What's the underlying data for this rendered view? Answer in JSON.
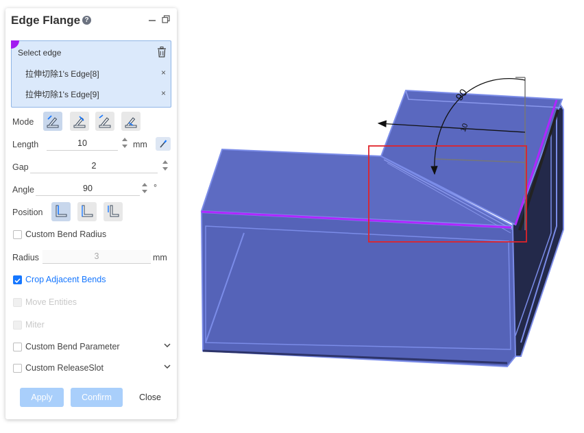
{
  "dialog": {
    "title": "Edge Flange",
    "help_glyph": "?",
    "select_edge_label": "Select edge",
    "selected_edges": [
      "拉伸切除1's Edge[8]",
      "拉伸切除1's Edge[9]"
    ],
    "remove_glyph": "×",
    "mode_label": "Mode",
    "length_label": "Length",
    "length_value": "10",
    "length_unit": "mm",
    "gap_label": "Gap",
    "gap_value": "2",
    "angle_label": "Angle",
    "angle_value": "90",
    "angle_unit": "°",
    "position_label": "Position",
    "custom_bend_radius_label": "Custom Bend Radius",
    "radius_label": "Radius",
    "radius_value": "3",
    "radius_unit": "mm",
    "crop_adjacent_bends_label": "Crop Adjacent Bends",
    "crop_adjacent_bends_checked": true,
    "move_entities_label": "Move Entities",
    "miter_label": "Miter",
    "custom_bend_parameter_label": "Custom Bend Parameter",
    "custom_release_slot_label": "Custom ReleaseSlot",
    "buttons": {
      "apply": "Apply",
      "confirm": "Confirm",
      "close": "Close"
    }
  },
  "viewport": {
    "angle_dimension_label": "90",
    "length_dimension_label": "10",
    "colors": {
      "part_face": "#5b6ac4",
      "part_edge": "#7b8ce8",
      "selected_edge": "#b026ff",
      "preview_box": "#e0242a"
    }
  }
}
